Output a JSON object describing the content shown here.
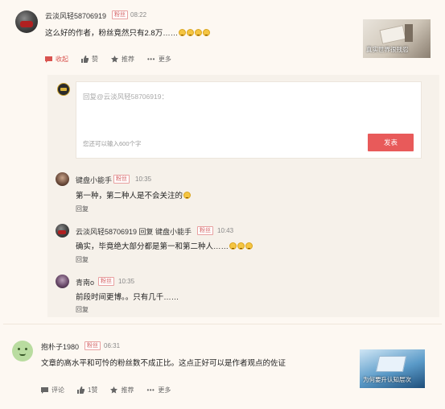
{
  "comment1": {
    "username": "云淡风轻58706919",
    "badge": "粉丝",
    "time": "08:22",
    "text": "这么好的作者，粉丝竟然只有2.8万……",
    "emoji_count": 4,
    "actions": {
      "collapse": "收起",
      "like": "赞",
      "recommend": "推荐",
      "more": "更多"
    },
    "thumbnail_caption": "真实世界很残忍"
  },
  "reply_input": {
    "placeholder": "回复@云淡风轻58706919：",
    "counter": "您还可以输入600个字",
    "submit": "发表"
  },
  "replies": [
    {
      "username": "键盘小能手",
      "badge": "粉丝",
      "time": "10:35",
      "text": "第一种，第二种人是不会关注的",
      "emoji_count": 1,
      "reply_label": "回复"
    },
    {
      "username": "云淡风轻58706919 回复 键盘小能手",
      "badge": "粉丝",
      "time": "10:43",
      "text": "确实，毕竟绝大部分都是第一和第二种人……",
      "emoji_count": 3,
      "reply_label": "回复"
    },
    {
      "username": "青南o",
      "badge": "粉丝",
      "time": "10:35",
      "text": "前段时间更博。。只有几千……",
      "emoji_count": 0,
      "reply_label": "回复"
    }
  ],
  "comment2": {
    "username": "抱朴子1980",
    "badge": "粉丝",
    "time": "06:31",
    "text": "文章的高水平和可怜的粉丝数不成正比。这点正好可以是作者观点的佐证",
    "actions": {
      "comment": "评论",
      "like": "1赞",
      "recommend": "推荐",
      "more": "更多"
    },
    "thumbnail_caption": "为何要升认知层次"
  },
  "colors": {
    "accent": "#e85a5a",
    "badge_border": "#e8a0a0",
    "panel_bg": "#f6f1ea"
  }
}
